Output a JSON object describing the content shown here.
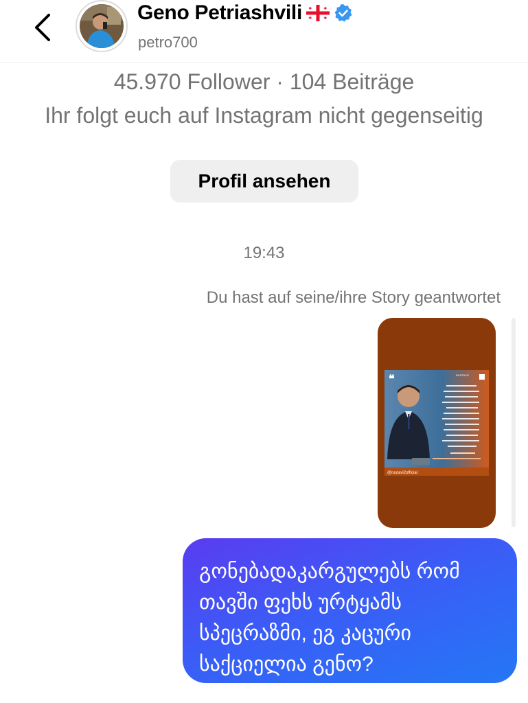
{
  "header": {
    "back_icon": "chevron-left-icon",
    "display_name": "Geno Petriashvili",
    "username": "petro700",
    "flag_icon": "georgia-flag-icon",
    "verified_icon": "verified-badge-icon",
    "verified_color": "#3897f0"
  },
  "profile": {
    "stats": "45.970 Follower · 104 Beiträge",
    "mutual_status": "Ihr folgt euch auf Instagram nicht gegenseitig",
    "view_profile_label": "Profil ansehen"
  },
  "conversation": {
    "timestamp": "19:43",
    "story_reply_note": "Du hast auf seine/ihre Story geantwortet",
    "story": {
      "background_color": "#8a3a0a",
      "watermark": "@rustavi2official",
      "brand": "RUSTAVI2"
    },
    "message": {
      "lines": [
        "გონებადაკარგულებს რომ",
        "თავში ფეხს ურტყამს",
        "სპეცრაზმი, ეგ კაცური",
        "საქციელია გენო?"
      ],
      "bubble_colors": [
        "#5a3cf0",
        "#2477f5"
      ]
    }
  }
}
